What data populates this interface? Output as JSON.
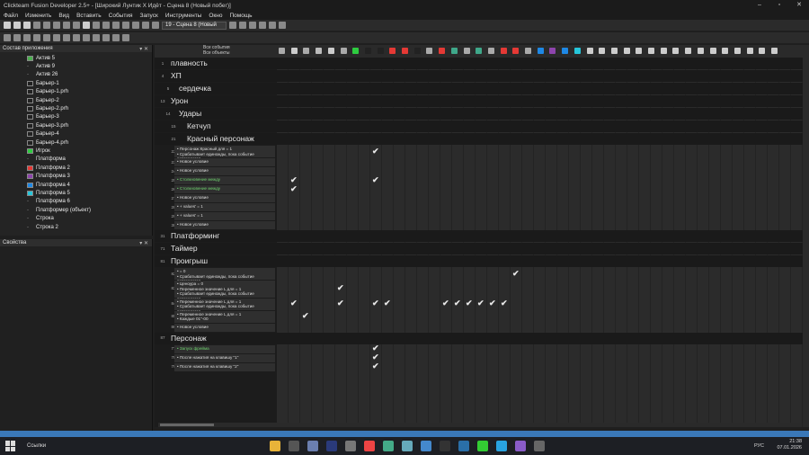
{
  "window": {
    "title": "Clickteam Fusion Developer 2.5+ - [Широкий Лунтик X Идёт - Сцена 8 (Новый побег)]"
  },
  "menu": [
    "Файл",
    "Изменить",
    "Вид",
    "Вставить",
    "События",
    "Запуск",
    "Инструменты",
    "Окно",
    "Помощь"
  ],
  "toolbar": {
    "scene_select": "19 - Сцена 8 (Новый"
  },
  "left_panel": {
    "title": "Состав приложения",
    "items": [
      {
        "label": "Актив 5",
        "color": "#4caf50"
      },
      {
        "label": "Актив 9",
        "color": ""
      },
      {
        "label": "Актив 26",
        "color": ""
      },
      {
        "label": "Барьер-1",
        "color": "#222222"
      },
      {
        "label": "Барьер-1.prh",
        "color": "#222222"
      },
      {
        "label": "Барьер-2",
        "color": "#222222"
      },
      {
        "label": "Барьер-2.prh",
        "color": "#222222"
      },
      {
        "label": "Барьер-3",
        "color": "#222222"
      },
      {
        "label": "Барьер-3.prh",
        "color": "#222222"
      },
      {
        "label": "Барьер-4",
        "color": "#222222"
      },
      {
        "label": "Барьер-4.prh",
        "color": "#222222"
      },
      {
        "label": "Игрок",
        "color": "#2ecc40"
      },
      {
        "label": "Платформа",
        "color": ""
      },
      {
        "label": "Платформа 2",
        "color": "#e53935"
      },
      {
        "label": "Платформа 3",
        "color": "#8e44ad"
      },
      {
        "label": "Платформа 4",
        "color": "#1e88e5"
      },
      {
        "label": "Платформа 5",
        "color": "#26c6da"
      },
      {
        "label": "Платформа 6",
        "color": ""
      },
      {
        "label": "Платформер (объект)",
        "color": ""
      },
      {
        "label": "Строка",
        "color": ""
      },
      {
        "label": "Строка 2",
        "color": ""
      }
    ]
  },
  "props_panel": {
    "title": "Свойства"
  },
  "event_header": {
    "all_events": "Все события",
    "all_objects": "Все объекты"
  },
  "rows": [
    {
      "type": "cat",
      "num": "1",
      "text": "плавность",
      "indent": 0
    },
    {
      "type": "cat",
      "num": "4",
      "text": "ХП",
      "indent": 0
    },
    {
      "type": "cat",
      "num": "5",
      "text": "сердечка",
      "indent": 1
    },
    {
      "type": "cat",
      "num": "13",
      "text": "Урон",
      "indent": 0
    },
    {
      "type": "cat",
      "num": "14",
      "text": "Удары",
      "indent": 1
    },
    {
      "type": "cat",
      "num": "15",
      "text": "Кетчуп",
      "indent": 2
    },
    {
      "type": "cat",
      "num": "21",
      "text": "Красный персонаж",
      "indent": 2
    },
    {
      "type": "cond",
      "num": "22",
      "lines": [
        "Персонаж:Красный для = 1",
        "Срабатывает единожды, пока событие повторяется"
      ],
      "checks": [
        8
      ]
    },
    {
      "type": "cond",
      "num": "23",
      "lines": [
        "Новое условие"
      ],
      "checks": []
    },
    {
      "type": "cond",
      "num": "24",
      "lines": [
        "Новое условие"
      ],
      "checks": []
    },
    {
      "type": "cond",
      "num": "25",
      "lines": [
        "Столкновение между"
      ],
      "checks": [
        1,
        8
      ],
      "green": true
    },
    {
      "type": "cond",
      "num": "26",
      "lines": [
        "Столкновение между"
      ],
      "checks": [
        1
      ],
      "green": true
    },
    {
      "type": "cond",
      "num": "27",
      "lines": [
        "Новое условие"
      ],
      "checks": []
    },
    {
      "type": "cond",
      "num": "28",
      "lines": [
        "+ values' = 1"
      ],
      "checks": []
    },
    {
      "type": "cond",
      "num": "29",
      "lines": [
        "+ values' = 1"
      ],
      "checks": []
    },
    {
      "type": "cond",
      "num": "30",
      "lines": [
        "Новое условие"
      ],
      "checks": []
    },
    {
      "type": "cat",
      "num": "31",
      "text": "Платформинг",
      "indent": 0
    },
    {
      "type": "cat",
      "num": "71",
      "text": "Таймер",
      "indent": 0
    },
    {
      "type": "cat",
      "num": "81",
      "text": "Проигрыш",
      "indent": 0
    },
    {
      "type": "cond",
      "num": "82",
      "lines": [
        "= 0",
        "Срабатывает единожды, пока событие повторяется"
      ],
      "checks": [
        20
      ]
    },
    {
      "type": "cond",
      "num": "83",
      "lines": [
        "Ценоура = 0",
        "Переменное значение L для = 1",
        "Срабатывает единожды, пока событие повторяется"
      ],
      "checks": [
        5
      ]
    },
    {
      "type": "cond",
      "num": "84",
      "lines": [
        "Переменное значение L для = 1",
        "Срабатывает единожды, пока событие повторяется"
      ],
      "checks": [
        1,
        5,
        8,
        9,
        14,
        15,
        16,
        17,
        18,
        19
      ]
    },
    {
      "type": "cond",
      "num": "85",
      "lines": [
        "Переменное значение L для = 1",
        "Каждые 01''-00"
      ],
      "checks": [
        2
      ]
    },
    {
      "type": "cond",
      "num": "86",
      "lines": [
        "Новое условие"
      ],
      "checks": []
    },
    {
      "type": "cat",
      "num": "87",
      "text": "Персонаж",
      "indent": 0
    },
    {
      "type": "cond",
      "num": "77",
      "lines": [
        "Запуск фрейма"
      ],
      "checks": [
        8
      ],
      "green": true
    },
    {
      "type": "cond",
      "num": "78",
      "lines": [
        "После нажатия на клавишу \"1\""
      ],
      "checks": [
        8
      ]
    },
    {
      "type": "cond",
      "num": "79",
      "lines": [
        "После нажатия на клавишу \"2\""
      ],
      "checks": [
        8
      ]
    }
  ],
  "taskbar": {
    "search": "Ссылки",
    "lang": "РУС",
    "time": "21:38",
    "date": "07.01.2026"
  }
}
